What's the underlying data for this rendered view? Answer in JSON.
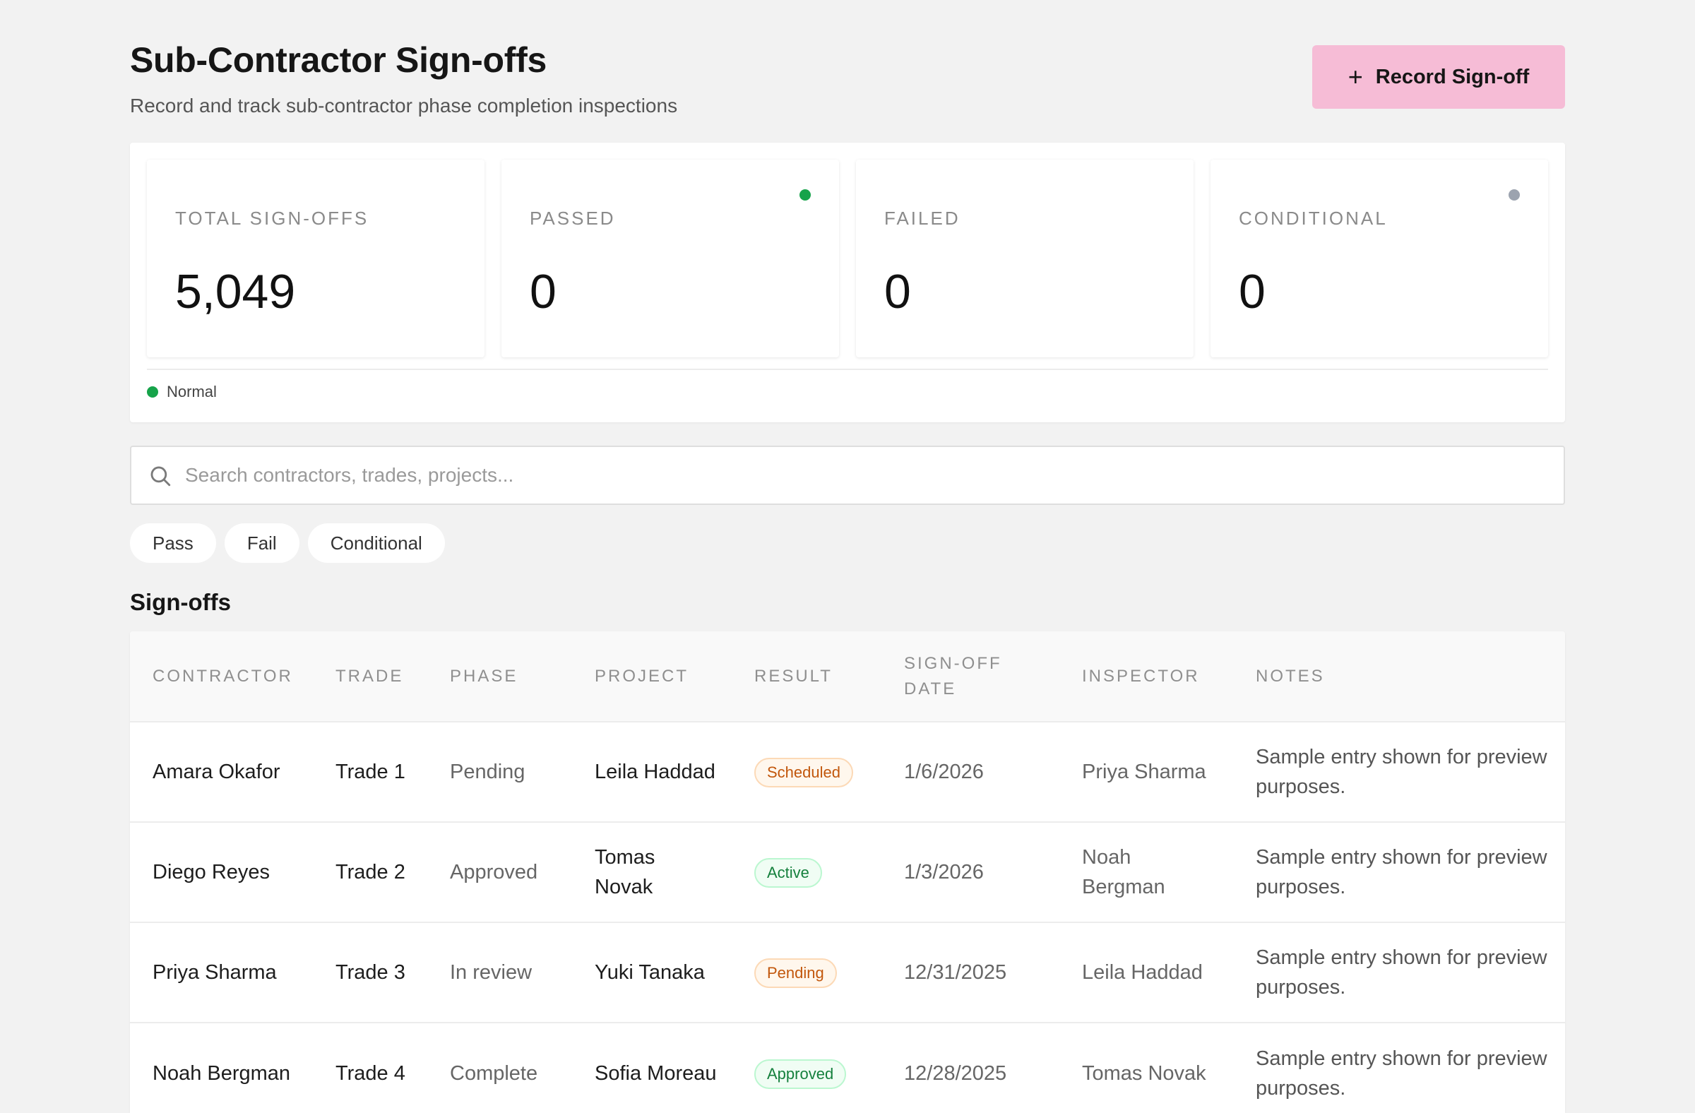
{
  "header": {
    "title": "Sub-Contractor Sign-offs",
    "subtitle": "Record and track sub-contractor phase completion inspections",
    "record_button_icon": "plus-icon",
    "record_button_label": "Record Sign-off"
  },
  "stats": [
    {
      "label": "TOTAL SIGN-OFFS",
      "value": "5,049",
      "indicator": null
    },
    {
      "label": "PASSED",
      "value": "0",
      "indicator": "#16a34a"
    },
    {
      "label": "FAILED",
      "value": "0",
      "indicator": null
    },
    {
      "label": "CONDITIONAL",
      "value": "0",
      "indicator": "#9ca3af"
    }
  ],
  "status": {
    "label": "Normal",
    "color": "#16a34a"
  },
  "search": {
    "icon": "search-icon",
    "placeholder": "Search contractors, trades, projects..."
  },
  "filters": [
    "Pass",
    "Fail",
    "Conditional"
  ],
  "section_title": "Sign-offs",
  "table": {
    "columns": [
      "CONTRACTOR",
      "TRADE",
      "PHASE",
      "PROJECT",
      "RESULT",
      "SIGN-OFF DATE",
      "INSPECTOR",
      "NOTES"
    ],
    "rows": [
      {
        "contractor": "Amara Okafor",
        "trade": "Trade 1",
        "phase": "Pending",
        "project": "Leila Haddad",
        "result": "Scheduled",
        "date": "1/6/2026",
        "inspector": "Priya Sharma",
        "notes": "Sample entry shown for preview purposes."
      },
      {
        "contractor": "Diego Reyes",
        "trade": "Trade 2",
        "phase": "Approved",
        "project": "Tomas Novak",
        "result": "Active",
        "date": "1/3/2026",
        "inspector": "Noah Bergman",
        "notes": "Sample entry shown for preview purposes."
      },
      {
        "contractor": "Priya Sharma",
        "trade": "Trade 3",
        "phase": "In review",
        "project": "Yuki Tanaka",
        "result": "Pending",
        "date": "12/31/2025",
        "inspector": "Leila Haddad",
        "notes": "Sample entry shown for preview purposes."
      },
      {
        "contractor": "Noah Bergman",
        "trade": "Trade 4",
        "phase": "Complete",
        "project": "Sofia Moreau",
        "result": "Approved",
        "date": "12/28/2025",
        "inspector": "Tomas Novak",
        "notes": "Sample entry shown for preview purposes."
      }
    ],
    "badge_colors": {
      "Scheduled": {
        "text": "#c2570c",
        "bg": "#fff7ed",
        "border": "#fcd9b6"
      },
      "Active": {
        "text": "#15803d",
        "bg": "#f0fdf4",
        "border": "#bbf7d0"
      },
      "Pending": {
        "text": "#c2570c",
        "bg": "#fff7ed",
        "border": "#fcd9b6"
      },
      "Approved": {
        "text": "#15803d",
        "bg": "#f0fdf4",
        "border": "#bbf7d0"
      }
    }
  }
}
